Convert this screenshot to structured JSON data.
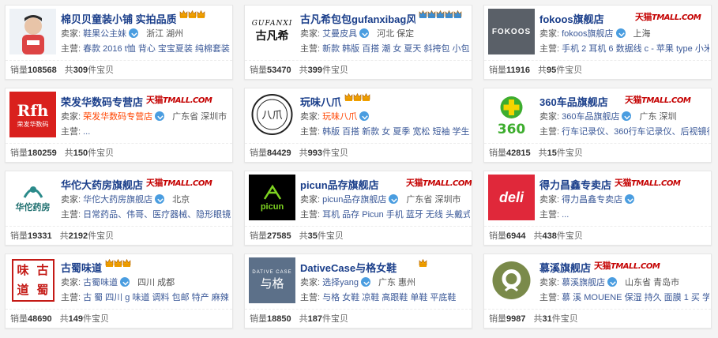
{
  "labels": {
    "seller": "卖家:",
    "main": "主营:",
    "sales": "销量",
    "total_prefix": "共",
    "total_suffix": "件宝贝",
    "tmall_cn": "天猫",
    "tmall_en": "TMALL.COM"
  },
  "shops": [
    {
      "name": "棉贝贝童装小铺 实拍品质...",
      "seller": "鞋果公主妹",
      "location": "浙江 湖州",
      "main": "春款 2016 t恤 背心 宝宝夏装 纯棉套装 短...",
      "sales": "108568",
      "total": "309",
      "tmall": false,
      "crowns": 3,
      "crown_color": "#f0a000",
      "seller_orange": false
    },
    {
      "name": "古凡希包包gufanxibag风...",
      "seller": "艾曼皮具",
      "location": "河北 保定",
      "main": "新款 韩版 百搭 潮 女 夏天 斜挎包 小包包...",
      "sales": "53470",
      "total": "399",
      "tmall": false,
      "crowns": 5,
      "crown_color": "#3a8fd8",
      "seller_orange": false
    },
    {
      "name": "fokoos旗舰店",
      "seller": "fokoos旗舰店",
      "location": "上海",
      "main": "手机 2 耳机 6 数据线 c - 苹果 type 小米 充...",
      "sales": "11916",
      "total": "95",
      "tmall": true,
      "crowns": 0,
      "crown_color": "",
      "seller_orange": false
    },
    {
      "name": "荣发华数码专营店",
      "seller": "荣发华数码专营店",
      "location": "广东省 深圳市",
      "main": "...",
      "sales": "180259",
      "total": "150",
      "tmall": true,
      "crowns": 0,
      "crown_color": "",
      "seller_orange": true
    },
    {
      "name": "玩味八爪",
      "seller": "玩味八爪",
      "location": "",
      "main": "韩版 百搭 新款 女 夏季 宽松 短袖 学生 chi...",
      "sales": "84429",
      "total": "993",
      "tmall": false,
      "crowns": 3,
      "crown_color": "#f0a000",
      "seller_orange": true
    },
    {
      "name": "360车品旗舰店",
      "seller": "360车品旗舰店",
      "location": "广东 深圳",
      "main": "行车记录仪、360行车记录仪、后视镜行车...",
      "sales": "42815",
      "total": "15",
      "tmall": true,
      "crowns": 0,
      "crown_color": "",
      "seller_orange": false
    },
    {
      "name": "华佗大药房旗舰店",
      "seller": "华佗大药房旗舰店",
      "location": "北京",
      "main": "日常药品、伟哥、医疗器械、隐形眼镜、...",
      "sales": "19331",
      "total": "2192",
      "tmall": true,
      "crowns": 0,
      "crown_color": "",
      "seller_orange": false
    },
    {
      "name": "picun品存旗舰店",
      "seller": "picun品存旗舰店",
      "location": "广东省 深圳市",
      "main": "耳机 品存 Picun 手机 蓝牙 无线 头戴式 话...",
      "sales": "27585",
      "total": "35",
      "tmall": true,
      "crowns": 0,
      "crown_color": "",
      "seller_orange": false
    },
    {
      "name": "得力昌鑫专卖店",
      "seller": "得力昌鑫专卖店",
      "location": "",
      "main": "...",
      "sales": "6944",
      "total": "438",
      "tmall": true,
      "crowns": 0,
      "crown_color": "",
      "seller_orange": false
    },
    {
      "name": "古蜀味道",
      "seller": "古蜀味道",
      "location": "四川 成都",
      "main": "古 蜀 四川 g 味道 调料 包邮 特产 麻辣 香...",
      "sales": "48690",
      "total": "149",
      "tmall": false,
      "crowns": 3,
      "crown_color": "#f0a000",
      "seller_orange": false
    },
    {
      "name": "DativeCase与格女鞋",
      "seller": "选择yang",
      "location": "广东 惠州",
      "main": "与格 女鞋 凉鞋 高跟鞋 单鞋 平底鞋",
      "sales": "18850",
      "total": "187",
      "tmall": false,
      "crowns": 1,
      "crown_color": "#f0a000",
      "seller_orange": false
    },
    {
      "name": "慕溪旗舰店",
      "seller": "慕溪旗舰店",
      "location": "山东省 青岛市",
      "main": "慕 溪 MOUENE 保湿 持久 面膜 1 买 学生 ...",
      "sales": "9987",
      "total": "31",
      "tmall": true,
      "crowns": 0,
      "crown_color": "",
      "seller_orange": false
    }
  ],
  "logos": [
    {
      "text": "",
      "bg": "#ffffff"
    },
    {
      "text": "古凡希",
      "sub": "GUFANXI",
      "bg": "#ffffff"
    },
    {
      "text": "FOKOOS",
      "bg": "#5a6068"
    },
    {
      "text": "Rfh",
      "sub": "荣发华数码",
      "bg": "#d9201d"
    },
    {
      "text": "八爪",
      "bg": "#ffffff"
    },
    {
      "text": "360",
      "bg": "#ffffff"
    },
    {
      "text": "华佗药房",
      "sub": "HUATUO DRUGSTORE",
      "bg": "#ffffff"
    },
    {
      "text": "picun",
      "bg": "#000000"
    },
    {
      "text": "deli",
      "bg": "#e0283a"
    },
    {
      "text": "古蜀味道",
      "bg": "#ffffff"
    },
    {
      "text": "与格",
      "sub": "DATIVE CASE",
      "bg": "#5c7089"
    },
    {
      "text": "",
      "bg": "#ffffff"
    }
  ]
}
